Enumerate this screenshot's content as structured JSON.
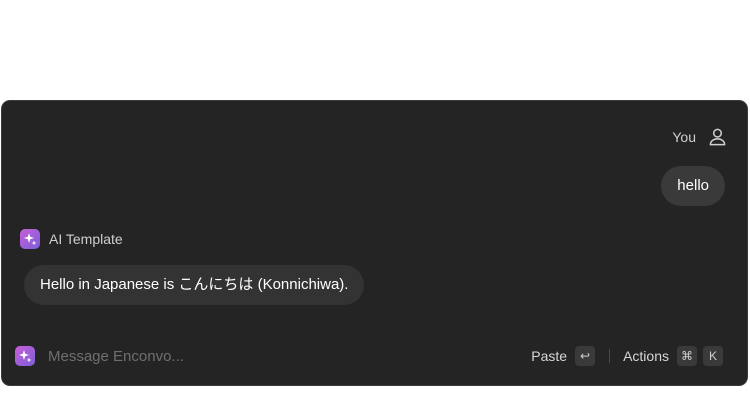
{
  "user": {
    "name": "You",
    "message": "hello"
  },
  "ai": {
    "name": "AI Template",
    "message": "Hello in Japanese is こんにちは (Konnichiwa)."
  },
  "composer": {
    "placeholder": "Message Enconvo...",
    "paste_label": "Paste",
    "paste_shortcut": "↩",
    "actions_label": "Actions",
    "actions_shortcut": [
      "⌘",
      "K"
    ]
  },
  "colors": {
    "window_bg": "#242424",
    "bubble_user": "#3a3a3a",
    "bubble_ai": "#333333",
    "ai_avatar_gradient": [
      "#c75fd8",
      "#7a5fd8"
    ]
  },
  "icons": {
    "user": "person-outline-icon",
    "ai_avatar": "sparkles-icon",
    "return_key": "return-key-icon"
  }
}
